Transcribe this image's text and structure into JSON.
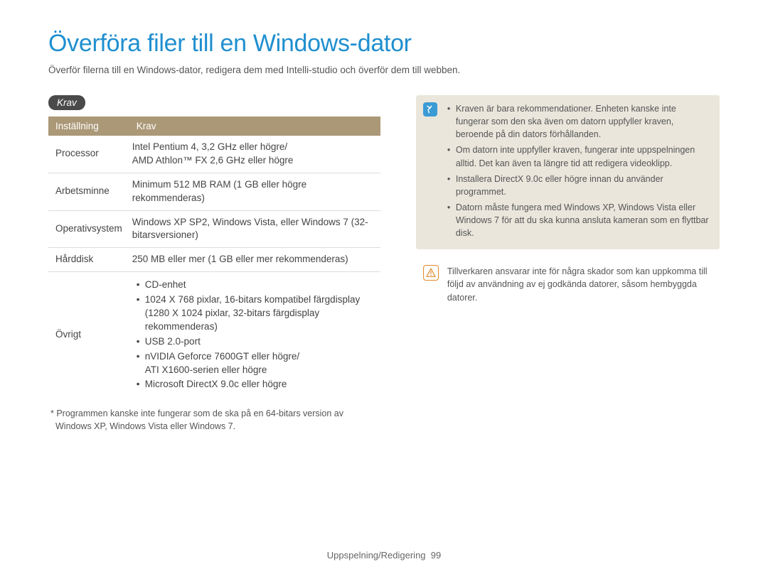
{
  "title": "Överföra filer till en Windows-dator",
  "subtitle": "Överför filerna till en Windows-dator, redigera dem med Intelli-studio och överför dem till webben.",
  "requirements": {
    "heading_pill": "Krav",
    "columns": {
      "setting": "Inställning",
      "req": "Krav"
    },
    "rows": [
      {
        "label": "Processor",
        "value": "Intel Pentium 4, 3,2 GHz eller högre/\nAMD Athlon™ FX 2,6 GHz eller högre"
      },
      {
        "label": "Arbetsminne",
        "value": "Minimum 512 MB RAM (1 GB eller högre rekommenderas)"
      },
      {
        "label": "Operativsystem",
        "value": "Windows XP SP2, Windows Vista, eller Windows 7 (32-bitarsversioner)"
      },
      {
        "label": "Hårddisk",
        "value": "250 MB eller mer (1 GB eller mer rekommenderas)"
      }
    ],
    "other_label": "Övrigt",
    "other_items": [
      "CD-enhet",
      "1024 X 768 pixlar, 16-bitars kompatibel färgdisplay (1280 X 1024 pixlar, 32-bitars färgdisplay rekommenderas)",
      "USB 2.0-port",
      "nVIDIA Geforce 7600GT eller högre/\nATI X1600-serien eller högre",
      "Microsoft DirectX 9.0c eller högre"
    ],
    "footnote": "* Programmen kanske inte fungerar som de ska på en 64-bitars version av Windows XP, Windows Vista eller Windows 7."
  },
  "notes": [
    "Kraven är bara rekommendationer. Enheten kanske inte fungerar som den ska även om datorn uppfyller kraven, beroende på din dators förhållanden.",
    "Om datorn inte uppfyller kraven, fungerar inte uppspelningen alltid. Det kan även ta längre tid att redigera videoklipp.",
    "Installera DirectX 9.0c eller högre innan du använder programmet.",
    "Datorn måste fungera med Windows XP, Windows Vista eller Windows 7 för att du ska kunna ansluta kameran som en flyttbar disk."
  ],
  "warning": "Tillverkaren ansvarar inte för några skador som kan uppkomma till följd av användning av ej godkända datorer, såsom hembyggda datorer.",
  "footer": {
    "section": "Uppspelning/Redigering",
    "page": "99"
  }
}
